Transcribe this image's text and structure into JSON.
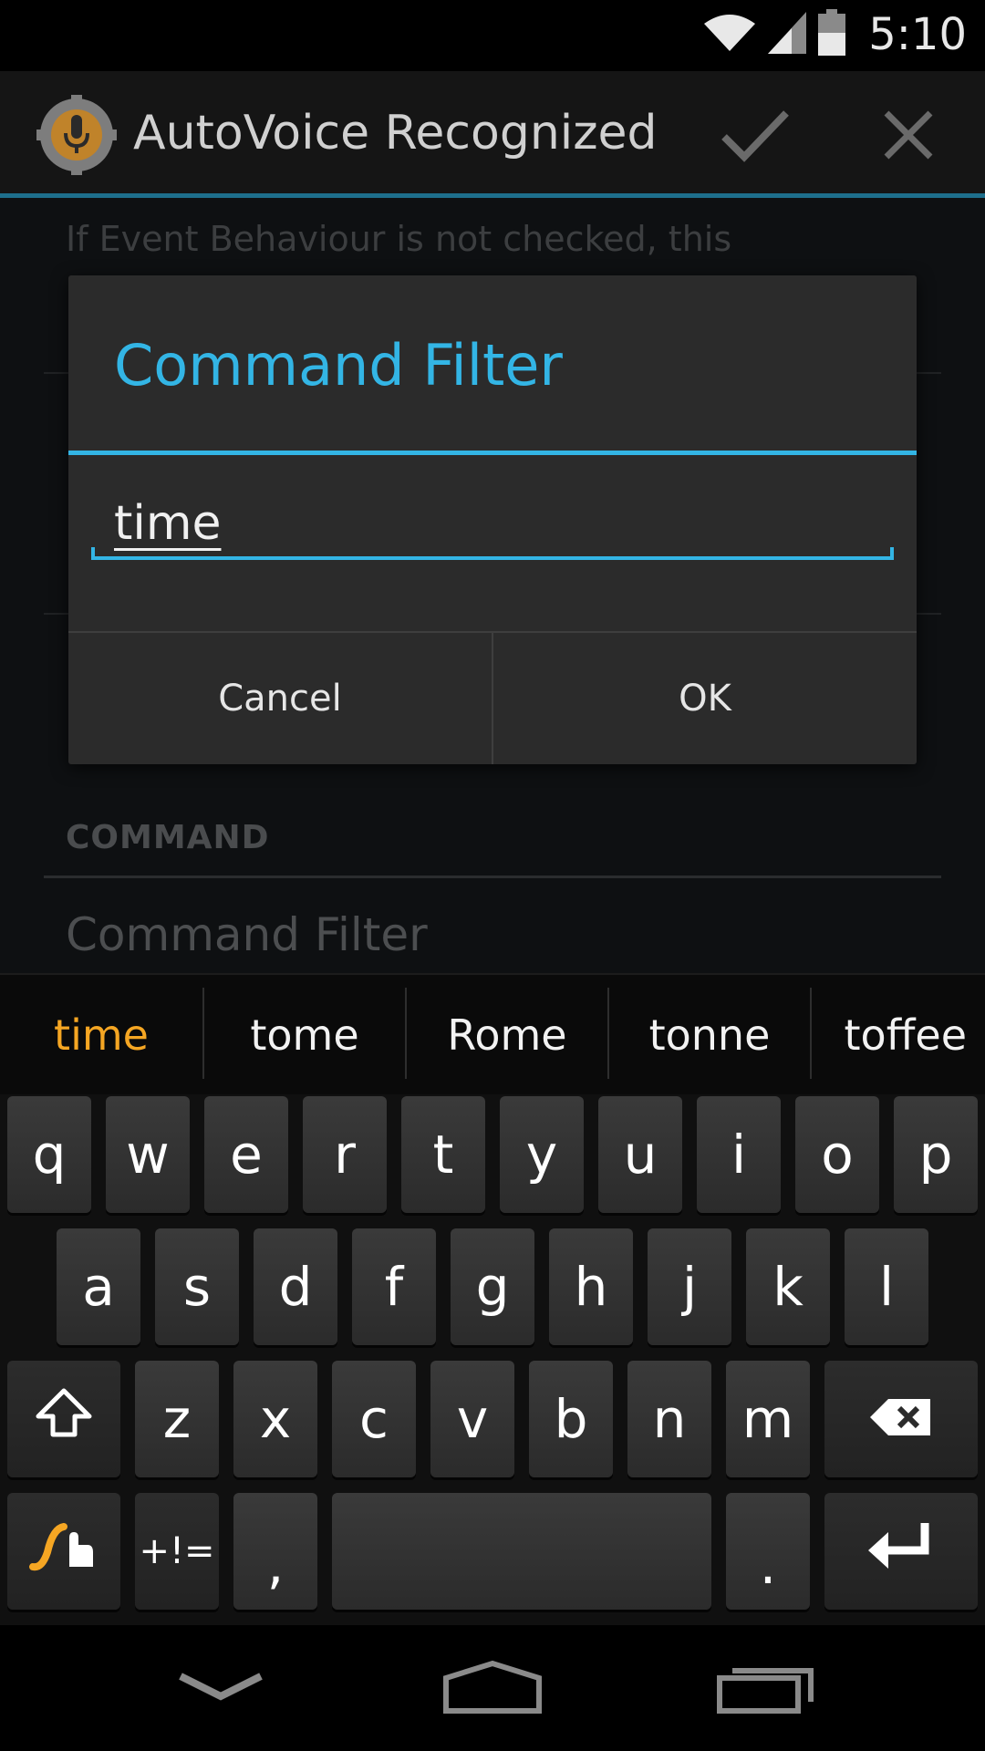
{
  "status_bar": {
    "time": "5:10",
    "icons": [
      "wifi-icon",
      "signal-icon",
      "battery-icon"
    ]
  },
  "action_bar": {
    "title": "AutoVoice Recognized",
    "icons": [
      "autovoice-app-icon",
      "checkmark-icon",
      "close-icon"
    ]
  },
  "background": {
    "description": "If Event Behaviour is not checked, this",
    "section_header": "COMMAND",
    "field_label": "Command Filter"
  },
  "dialog": {
    "title": "Command Filter",
    "input_value": "time",
    "cancel_label": "Cancel",
    "ok_label": "OK"
  },
  "keyboard": {
    "suggestions": [
      "time",
      "tome",
      "Rome",
      "tonne",
      "toffee"
    ],
    "row1": [
      "q",
      "w",
      "e",
      "r",
      "t",
      "y",
      "u",
      "i",
      "o",
      "p"
    ],
    "row2": [
      "a",
      "s",
      "d",
      "f",
      "g",
      "h",
      "j",
      "k",
      "l"
    ],
    "row3": [
      "z",
      "x",
      "c",
      "v",
      "b",
      "n",
      "m"
    ],
    "symbols_label": "+!=",
    "comma_label": ",",
    "period_label": ".",
    "icons": [
      "shift-icon",
      "backspace-icon",
      "swype-icon",
      "enter-icon"
    ]
  },
  "nav_bar": {
    "icons": [
      "back-down-icon",
      "home-icon",
      "recents-icon"
    ]
  },
  "colors": {
    "accent": "#33b5e5",
    "suggestion_highlight": "#f5a623",
    "dialog_bg": "#2b2b2b"
  }
}
